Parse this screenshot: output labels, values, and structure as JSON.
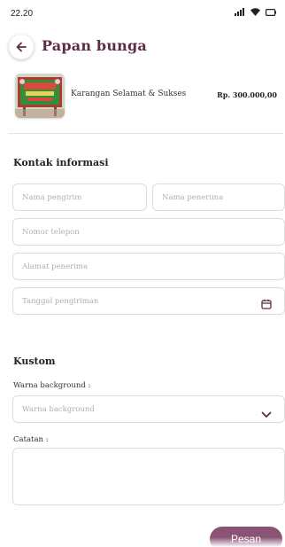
{
  "status_bar": {
    "time": "22.20",
    "icons": [
      "signal-icon",
      "wifi-icon",
      "battery-icon"
    ]
  },
  "header": {
    "title": "Papan bunga",
    "back_icon": "arrow-left-icon"
  },
  "product": {
    "name": "Karangan Selamat & Sukses",
    "price": "Rp. 300.000,00"
  },
  "contact_section": {
    "title": "Kontak informasi",
    "sender_placeholder": "Nama pengirim",
    "recipient_placeholder": "Nama penerima",
    "phone_placeholder": "Nomor telepon",
    "address_placeholder": "Alamat penerima",
    "date_placeholder": "Tanggal pengiriman",
    "date_icon": "calendar-icon"
  },
  "custom_section": {
    "title": "Kustom",
    "background_label": "Warna background :",
    "background_placeholder": "Warna background",
    "dropdown_icon": "chevron-down-icon",
    "notes_label": "Catatan :",
    "notes_placeholder": ""
  },
  "actions": {
    "order_label": "Pesan"
  },
  "colors": {
    "accent": "#5c2d47",
    "button": "#8a5374",
    "border": "#dcdcdc",
    "placeholder": "#b0b0b0"
  }
}
